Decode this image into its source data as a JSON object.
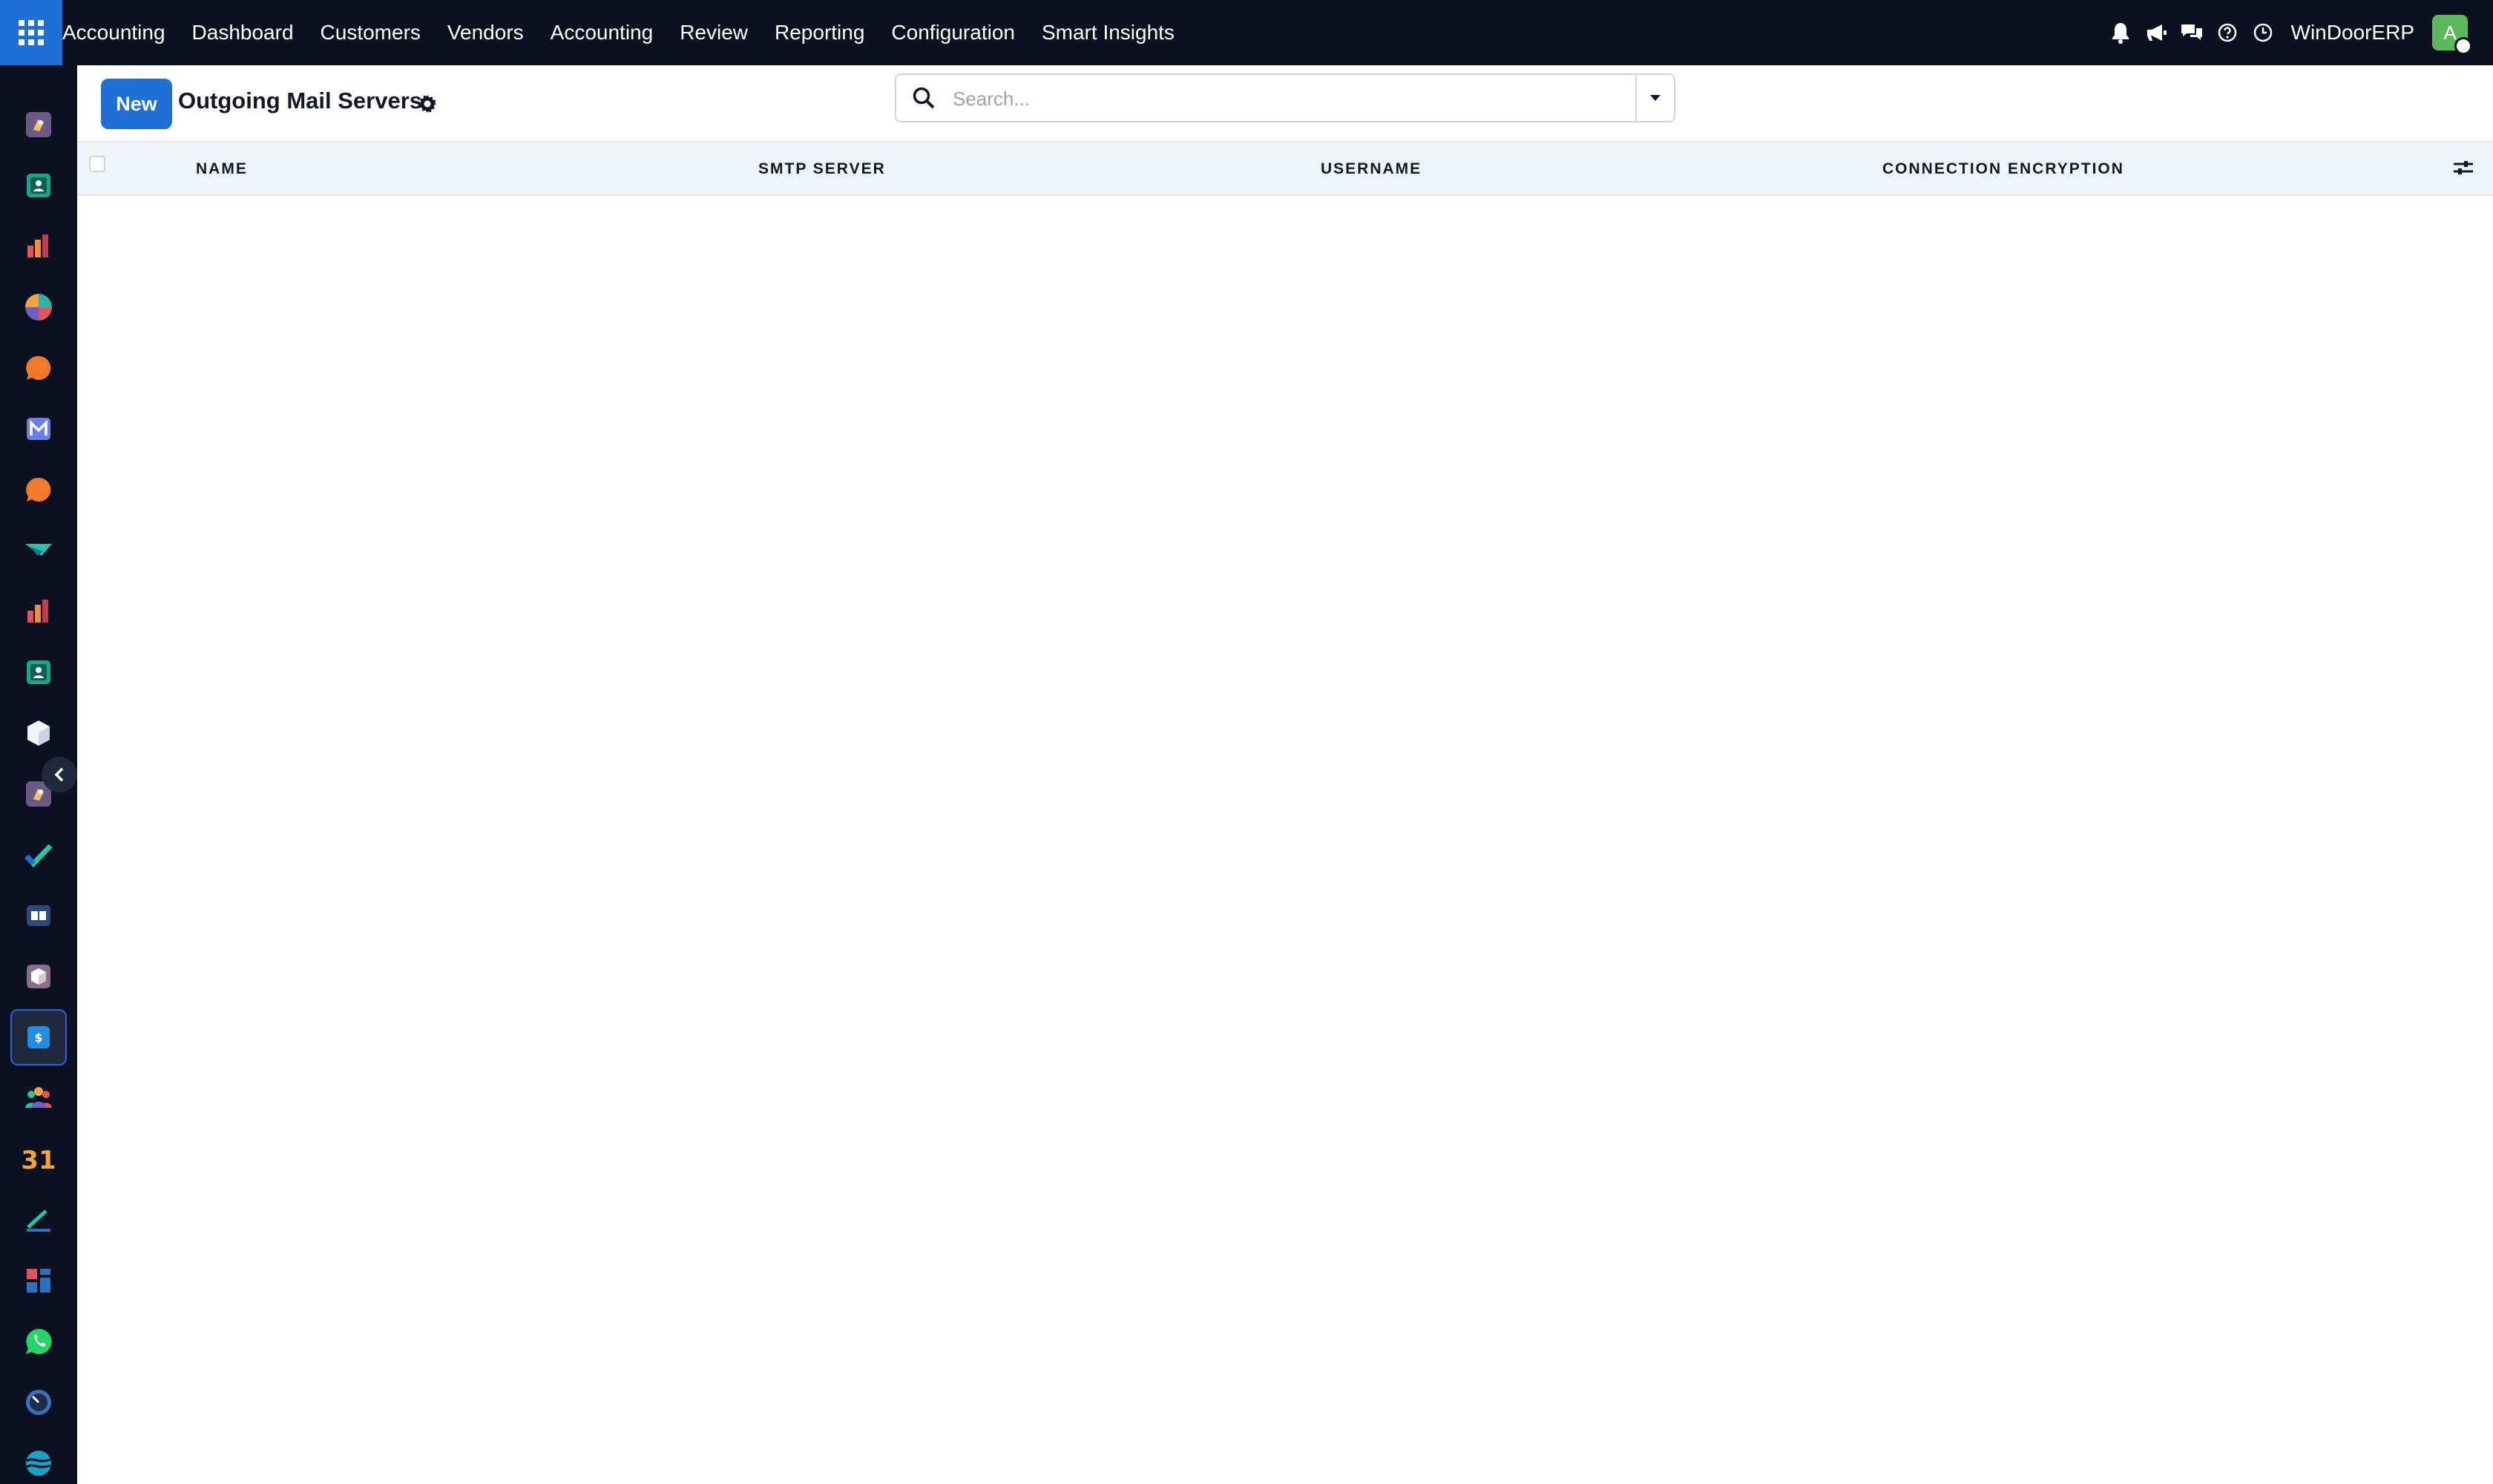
{
  "app": {
    "name": "Accounting"
  },
  "menu": [
    {
      "label": "Dashboard"
    },
    {
      "label": "Customers"
    },
    {
      "label": "Vendors"
    },
    {
      "label": "Accounting"
    },
    {
      "label": "Review"
    },
    {
      "label": "Reporting"
    },
    {
      "label": "Configuration"
    },
    {
      "label": "Smart Insights"
    }
  ],
  "topbar": {
    "company": "WinDoorERP",
    "avatar_initial": "A",
    "icons": [
      "bell-icon",
      "megaphone-icon",
      "chat-icon",
      "help-icon",
      "clock-icon"
    ]
  },
  "sidebar": {
    "icons": [
      "rocket-app-icon",
      "contacts-app-icon",
      "chart-app-icon",
      "pie-app-icon",
      "discuss-app-icon",
      "mail-app-icon",
      "discuss-alt-app-icon",
      "check-app-icon",
      "stats-app-icon",
      "contacts-alt-app-icon",
      "cube-app-icon",
      "rocket-alt-app-icon",
      "tick-app-icon",
      "book-app-icon",
      "package-app-icon",
      "invoice-app-icon",
      "team-app-icon",
      "calendar-app-icon",
      "sign-app-icon",
      "dashboard-app-icon",
      "whatsapp-app-icon",
      "gauge-app-icon",
      "wave-app-icon"
    ],
    "active_index": 15,
    "calendar_day": "31"
  },
  "control": {
    "new_label": "New",
    "title": "Outgoing Mail Servers",
    "search_placeholder": "Search..."
  },
  "table": {
    "columns": [
      "NAME",
      "SMTP SERVER",
      "USERNAME",
      "CONNECTION ENCRYPTION"
    ],
    "rows": []
  },
  "colors": {
    "navbar": "#0b1120",
    "primary": "#1f6fd6",
    "header_bg": "#eef5fd",
    "avatar": "#5cb85c"
  }
}
